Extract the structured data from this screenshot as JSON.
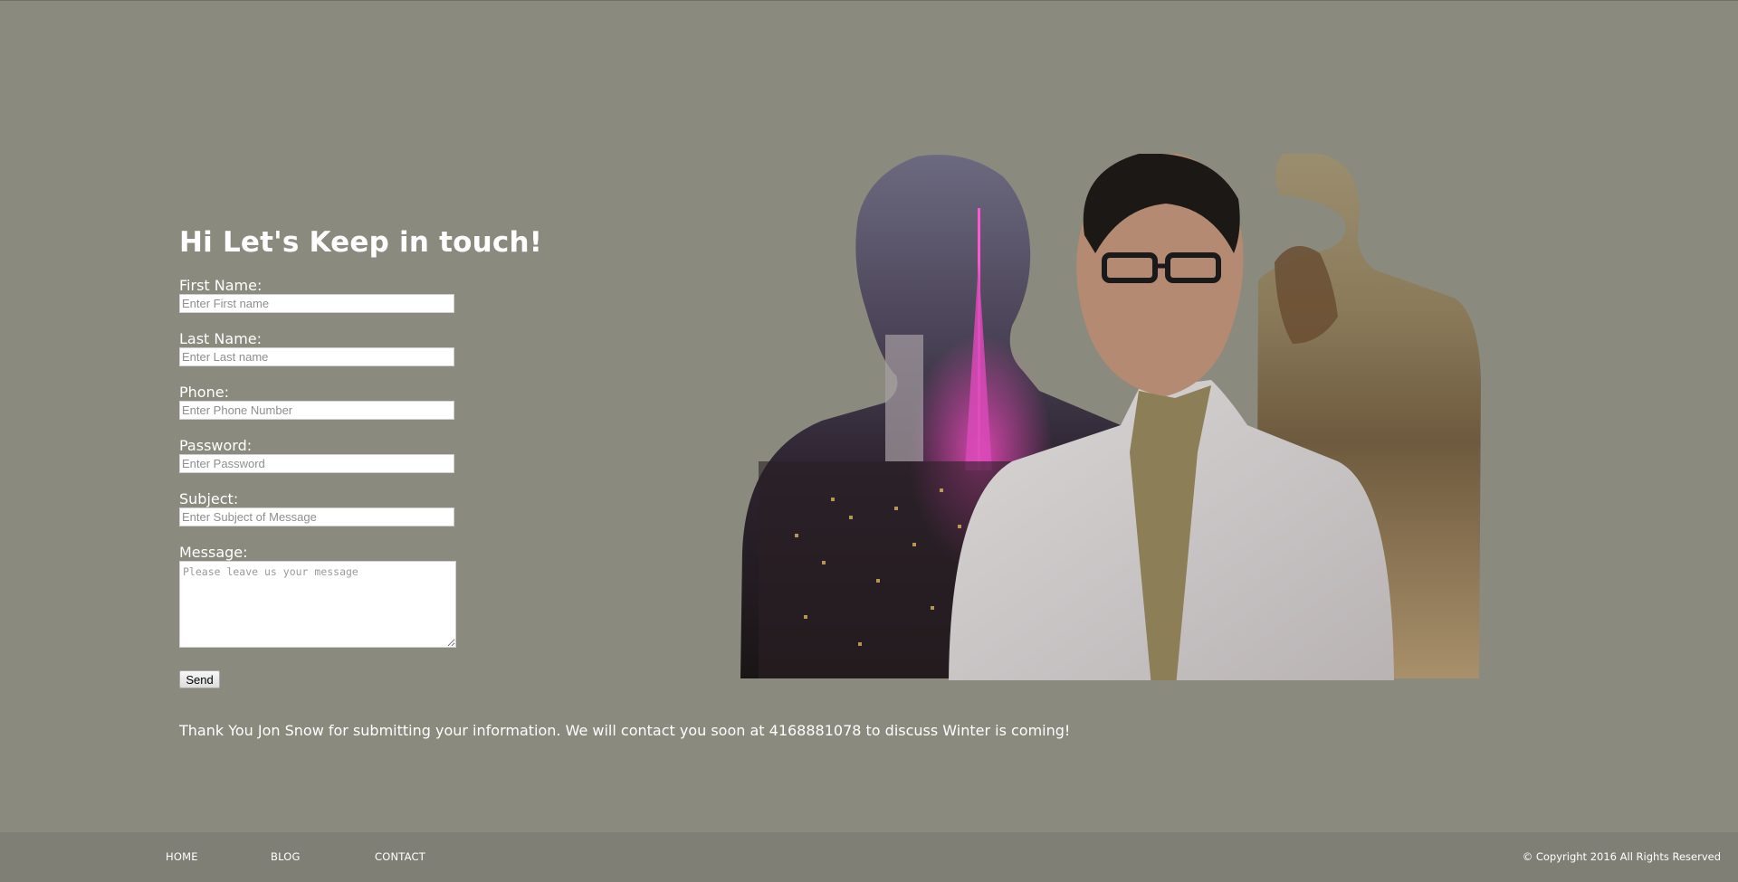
{
  "form": {
    "heading": "Hi Let's Keep in touch!",
    "first_name": {
      "label": "First Name:",
      "placeholder": "Enter First name"
    },
    "last_name": {
      "label": "Last Name:",
      "placeholder": "Enter Last name"
    },
    "phone": {
      "label": "Phone:",
      "placeholder": "Enter Phone Number"
    },
    "password": {
      "label": "Password:",
      "placeholder": "Enter Password"
    },
    "subject": {
      "label": "Subject:",
      "placeholder": "Enter Subject of Message"
    },
    "message": {
      "label": "Message:",
      "placeholder": "Please leave us your message"
    },
    "send_label": "Send",
    "thank_you": "Thank You Jon Snow for submitting your information. We will contact you soon at 4168881078 to discuss Winter is coming!"
  },
  "hero": {
    "figures": [
      "city-night-silhouette",
      "portrait-photo",
      "seaside-rock-silhouette"
    ]
  },
  "footer": {
    "nav": {
      "home": "HOME",
      "blog": "BLOG",
      "contact": "CONTACT"
    },
    "copyright": "© Copyright 2016 All Rights Reserved"
  },
  "colors": {
    "background": "#8a8a7e",
    "footer": "#7f7f76",
    "text": "#ffffff"
  }
}
